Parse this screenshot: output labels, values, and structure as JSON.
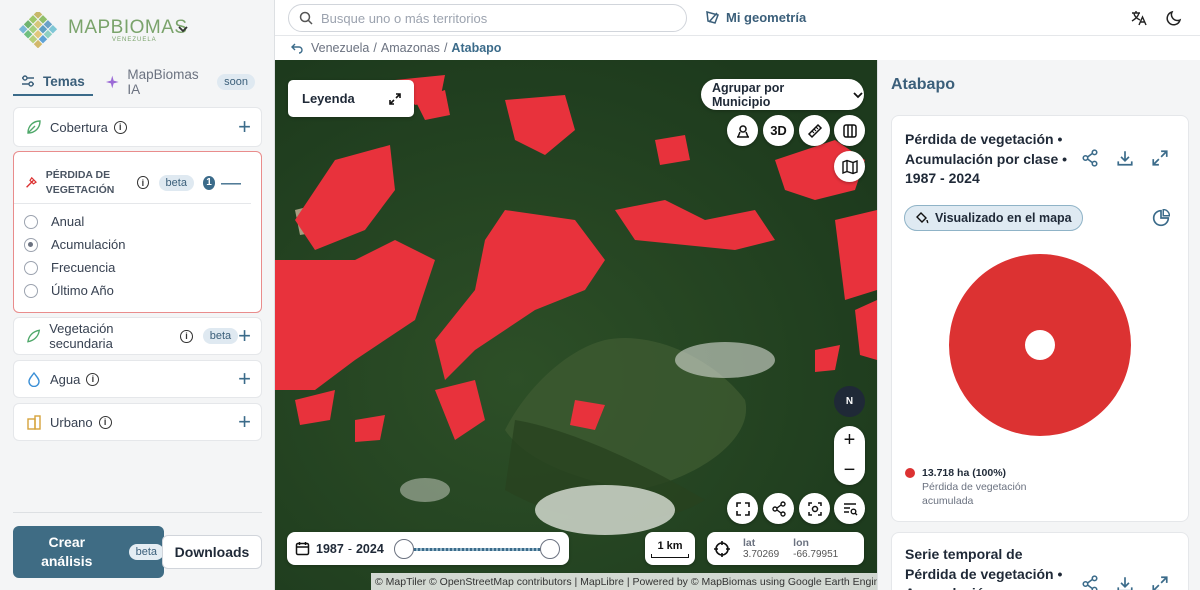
{
  "app": {
    "logo_name": "MAPBIOMAS",
    "logo_sub": "VENEZUELA"
  },
  "tabs": [
    {
      "label": "Temas",
      "icon": "sliders-icon",
      "active": true
    },
    {
      "label": "MapBiomas IA",
      "icon": "sparkle-icon",
      "badge": "soon"
    }
  ],
  "layers": {
    "cobertura": {
      "label": "Cobertura",
      "icon": "leaf-icon"
    },
    "perdida": {
      "label": "PÉRDIDA DE VEGETACIÓN",
      "badge": "beta",
      "count": "1",
      "options": [
        {
          "label": "Anual",
          "checked": false
        },
        {
          "label": "Acumulación",
          "checked": true
        },
        {
          "label": "Frecuencia",
          "checked": false
        },
        {
          "label": "Último Año",
          "checked": false
        }
      ]
    },
    "vegetacion": {
      "label": "Vegetación secundaria",
      "badge": "beta"
    },
    "agua": {
      "label": "Agua"
    },
    "urbano": {
      "label": "Urbano"
    }
  },
  "actions": {
    "crear_label": "Crear análisis",
    "crear_badge": "beta",
    "downloads_label": "Downloads"
  },
  "topbar": {
    "search_placeholder": "Busque uno o más territorios",
    "geometria_label": "Mi geometría"
  },
  "breadcrumb": {
    "items": [
      "Venezuela",
      "Amazonas"
    ],
    "current": "Atabapo"
  },
  "map": {
    "leyenda_label": "Leyenda",
    "agrupar_label": "Agrupar por Municipio",
    "btn_3d": "3D",
    "compass": "N",
    "year_start": "1987",
    "year_end": "2024",
    "scale_label": "1 km",
    "lat_label": "lat",
    "lat_value": "3.70269",
    "lon_label": "lon",
    "lon_value": "-66.79951",
    "attribution": "© MapTiler © OpenStreetMap contributors | MapLibre | Powered by © MapBiomas using Google Earth Engine",
    "loss_color": "#e8323c"
  },
  "panel": {
    "title": "Atabapo",
    "card1": {
      "title": "Pérdida de vegetación • Acumulación por clase • 1987 - 2024",
      "pill_label": "Visualizado en el mapa",
      "legend_value": "13.718 ha (100%)",
      "legend_label": "Pérdida de vegetación acumulada",
      "color": "#dc3232"
    },
    "card2": {
      "title": "Serie temporal de Pérdida de vegetación • Acumulación por"
    }
  },
  "chart_data": {
    "type": "pie",
    "categories": [
      "Pérdida de vegetación acumulada"
    ],
    "values": [
      13718
    ],
    "percent": [
      100
    ],
    "unit": "ha"
  }
}
